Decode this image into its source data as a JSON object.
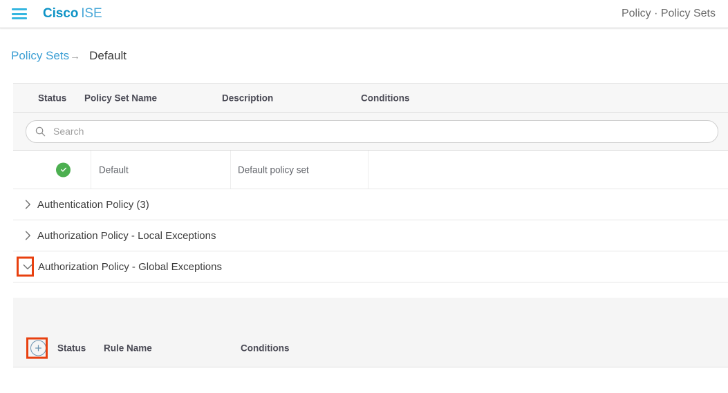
{
  "header": {
    "menu_icon": "hamburger-icon",
    "brand_primary": "Cisco",
    "brand_secondary": "ISE",
    "breadcrumb": "Policy · Policy Sets"
  },
  "page": {
    "parent_link": "Policy Sets",
    "arrow": "→",
    "current": "Default"
  },
  "policy_set_table": {
    "columns": [
      "Status",
      "Policy Set Name",
      "Description",
      "Conditions"
    ],
    "search": {
      "placeholder": "Search",
      "value": "",
      "icon": "search-icon"
    },
    "rows": [
      {
        "status_icon": "status-ok-icon",
        "status_glyph": "✓",
        "name": "Default",
        "description": "Default policy set",
        "conditions": ""
      }
    ]
  },
  "sections": [
    {
      "label": "Authentication Policy (3)",
      "expanded": false,
      "chevron": "chevron-right-icon"
    },
    {
      "label": "Authorization Policy - Local Exceptions",
      "expanded": false,
      "chevron": "chevron-right-icon"
    },
    {
      "label": "Authorization Policy - Global Exceptions",
      "expanded": true,
      "chevron": "chevron-down-icon"
    }
  ],
  "expanded_panel": {
    "add_button_icon": "plus-circle-icon",
    "columns": [
      "Status",
      "Rule Name",
      "Conditions"
    ]
  },
  "colors": {
    "brand_blue": "#0d93c6",
    "link_blue": "#3c9fd4",
    "menu_blue": "#35b6e0",
    "status_green": "#4caf50",
    "annotation_red": "#e8400f",
    "panel_gray": "#f5f5f5",
    "header_gray": "#f7f7f7"
  }
}
